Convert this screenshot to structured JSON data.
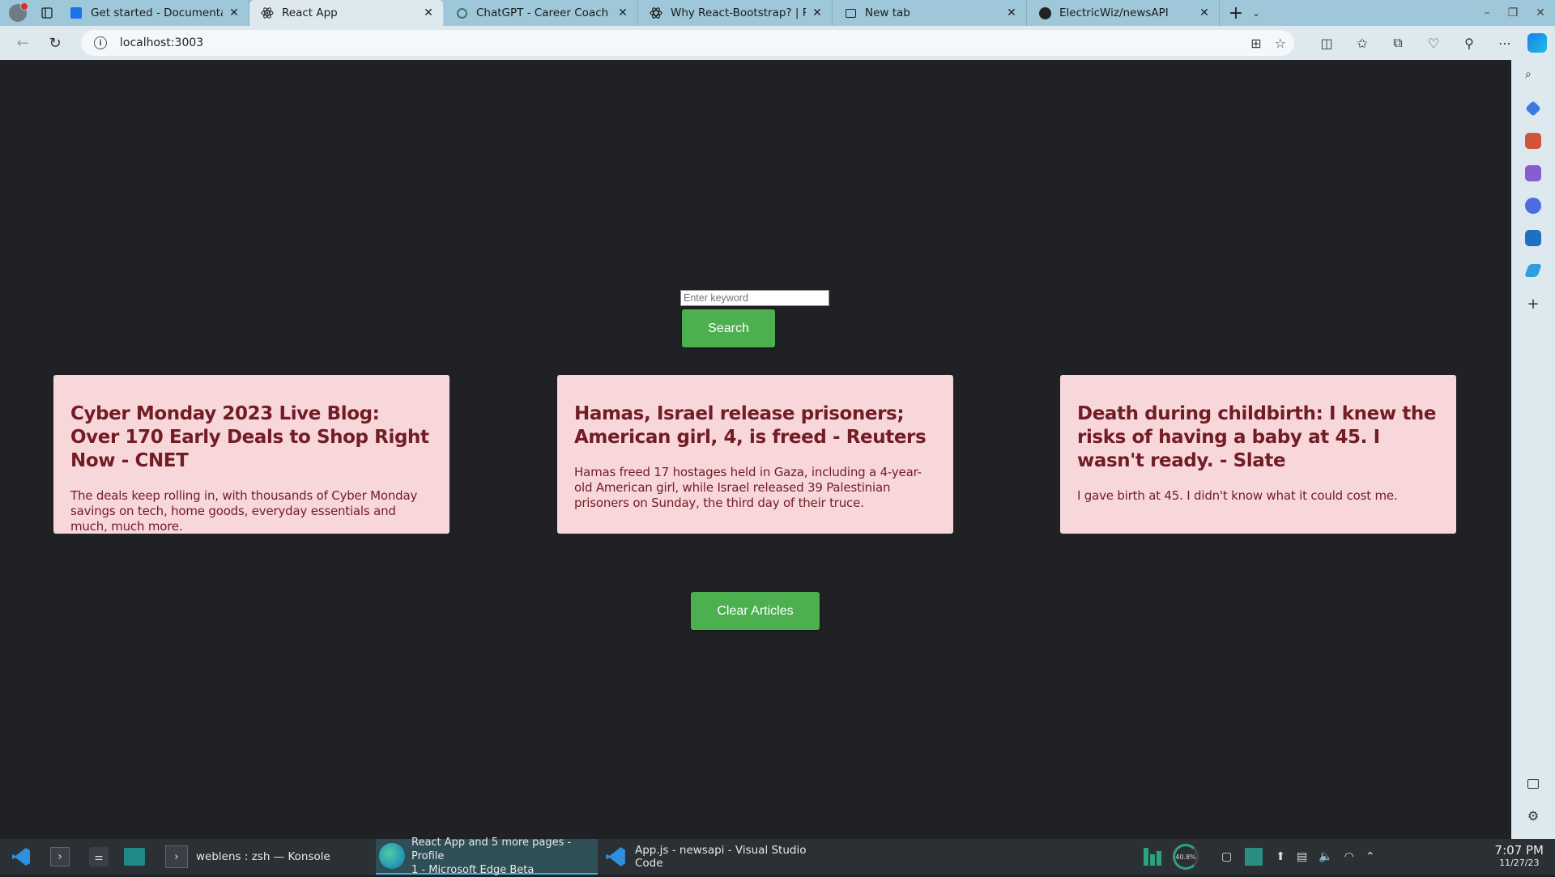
{
  "browser": {
    "tabs": [
      {
        "title": "Get started - Documentation",
        "favicon": "documentation-icon"
      },
      {
        "title": "React App",
        "favicon": "react-icon",
        "active": true
      },
      {
        "title": "ChatGPT - Career Coach",
        "favicon": "chatgpt-icon"
      },
      {
        "title": "Why React-Bootstrap? | React",
        "favicon": "react-bootstrap-icon"
      },
      {
        "title": "New tab",
        "favicon": "new-tab-icon"
      },
      {
        "title": "ElectricWiz/newsAPI",
        "favicon": "github-icon"
      }
    ],
    "address": "localhost:3003",
    "accent": "#9ec7d9"
  },
  "page": {
    "search_placeholder": "Enter keyword",
    "search_value": "",
    "search_button": "Search",
    "clear_button": "Clear Articles",
    "articles": [
      {
        "title": "Cyber Monday 2023 Live Blog: Over 170 Early Deals to Shop Right Now - CNET",
        "description": "The deals keep rolling in, with thousands of Cyber Monday savings on tech, home goods, everyday essentials and much, much more."
      },
      {
        "title": "Hamas, Israel release prisoners; American girl, 4, is freed - Reuters",
        "description": "Hamas freed 17 hostages held in Gaza, including a 4-year-old American girl, while Israel released 39 Palestinian prisoners on Sunday, the third day of their truce."
      },
      {
        "title": "Death during childbirth: I knew the risks of having a baby at 45. I wasn't ready. - Slate",
        "description": "I gave birth at 45. I didn't know what it could cost me."
      }
    ],
    "colors": {
      "button": "#4caf50",
      "card_bg": "#f8d7da",
      "card_text": "#721c24",
      "background": "#202124"
    }
  },
  "taskbar": {
    "tasks": [
      {
        "label": "weblens : zsh — Konsole"
      },
      {
        "label_line1": "React App and 5 more pages - Profile",
        "label_line2": "1 - Microsoft Edge Beta"
      },
      {
        "label": "App.js - newsapi - Visual Studio Code"
      }
    ],
    "cpu_percent": "40.8%",
    "time": "7:07 PM",
    "date": "11/27/23"
  }
}
